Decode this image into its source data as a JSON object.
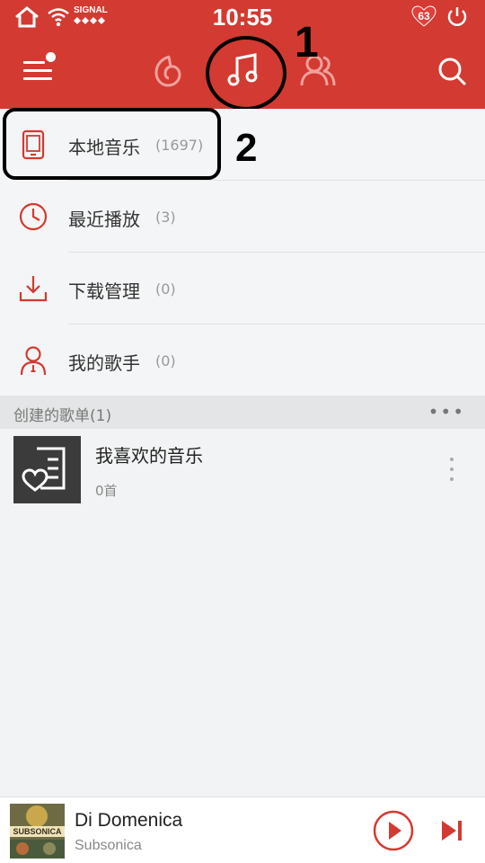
{
  "status_bar": {
    "time": "10:55",
    "signal_label": "SIGNAL",
    "notification_count": "63",
    "icons": [
      "home-icon",
      "wifi-icon",
      "signal-icon",
      "heart-badge-icon",
      "power-icon"
    ]
  },
  "top_nav": {
    "icons": [
      "menu-icon",
      "cloud-music-icon",
      "my-music-icon",
      "friends-icon",
      "search-icon"
    ],
    "active": "my-music-icon",
    "accent_color": "#d33a31"
  },
  "annotations": {
    "marker_1": "1",
    "marker_2": "2"
  },
  "menu": {
    "items": [
      {
        "label": "本地音乐",
        "count": "(1697)",
        "icon": "phone-icon"
      },
      {
        "label": "最近播放",
        "count": "(3)",
        "icon": "clock-icon"
      },
      {
        "label": "下载管理",
        "count": "(0)",
        "icon": "download-icon"
      },
      {
        "label": "我的歌手",
        "count": "(0)",
        "icon": "singer-icon"
      }
    ]
  },
  "playlists_section": {
    "title": "创建的歌单(1)",
    "more": "•••"
  },
  "playlist": {
    "name": "我喜欢的音乐",
    "count": "0首",
    "icon": "heart-list-icon"
  },
  "now_playing": {
    "song": "Di Domenica",
    "artist": "Subsonica",
    "cover_text": "SUBSONICA",
    "icons": [
      "play-icon",
      "next-icon"
    ]
  }
}
